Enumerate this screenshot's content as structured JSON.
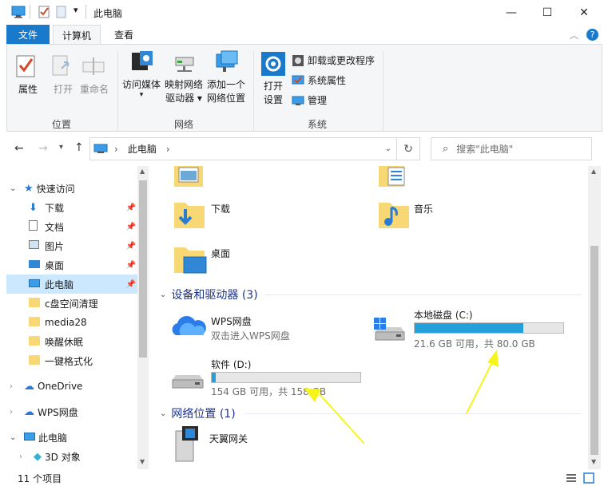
{
  "window": {
    "title": "此电脑",
    "controls": {
      "minimize": "—",
      "maximize": "☐",
      "close": "✕"
    }
  },
  "ribbon": {
    "tabs": [
      {
        "label": "文件"
      },
      {
        "label": "计算机"
      },
      {
        "label": "查看"
      }
    ],
    "groups": {
      "location": {
        "label": "位置",
        "buttons": [
          {
            "label": "属性",
            "enabled": true
          },
          {
            "label": "打开",
            "enabled": false
          },
          {
            "label": "重命名",
            "enabled": false
          }
        ]
      },
      "network": {
        "label": "网络",
        "buttons": [
          {
            "line1": "访问媒体",
            "line2": "▾"
          },
          {
            "line1": "映射网络",
            "line2": "驱动器 ▾"
          },
          {
            "line1": "添加一个",
            "line2": "网络位置"
          }
        ]
      },
      "system": {
        "label": "系统",
        "open_settings": {
          "line1": "打开",
          "line2": "设置"
        },
        "small": [
          {
            "label": "卸载或更改程序"
          },
          {
            "label": "系统属性"
          },
          {
            "label": "管理"
          }
        ]
      }
    }
  },
  "address": {
    "path": "此电脑",
    "separator": "›",
    "search_placeholder": "搜索\"此电脑\""
  },
  "nav": {
    "quick_access": "快速访问",
    "items": [
      {
        "label": "下载",
        "pinned": true
      },
      {
        "label": "文档",
        "pinned": true
      },
      {
        "label": "图片",
        "pinned": true
      },
      {
        "label": "桌面",
        "pinned": true
      },
      {
        "label": "此电脑",
        "pinned": true,
        "selected": true
      },
      {
        "label": "c盘空间清理"
      },
      {
        "label": "media28"
      },
      {
        "label": "唤醒休眠"
      },
      {
        "label": "一键格式化"
      }
    ],
    "onedrive": "OneDrive",
    "wps": "WPS网盘",
    "this_pc": "此电脑",
    "objects3d": "3D 对象"
  },
  "content": {
    "folders": [
      {
        "label": "下载"
      },
      {
        "label": "音乐"
      },
      {
        "label": "桌面"
      }
    ],
    "devices_header": "设备和驱动器 (3)",
    "devices": {
      "wps": {
        "name": "WPS网盘",
        "sub": "双击进入WPS网盘"
      },
      "c_drive": {
        "name": "本地磁盘 (C:)",
        "sub": "21.6 GB 可用，共 80.0 GB",
        "used_fraction": 0.73
      },
      "d_drive": {
        "name": "软件 (D:)",
        "sub": "154 GB 可用，共 158 GB",
        "used_fraction": 0.025
      }
    },
    "network_header": "网络位置 (1)",
    "network": {
      "name": "天翼网关"
    }
  },
  "status": {
    "count": "11 个项目"
  },
  "colors": {
    "accent": "#1979ca",
    "bar_fill": "#26a0da",
    "annotation": "#f5f51a"
  }
}
